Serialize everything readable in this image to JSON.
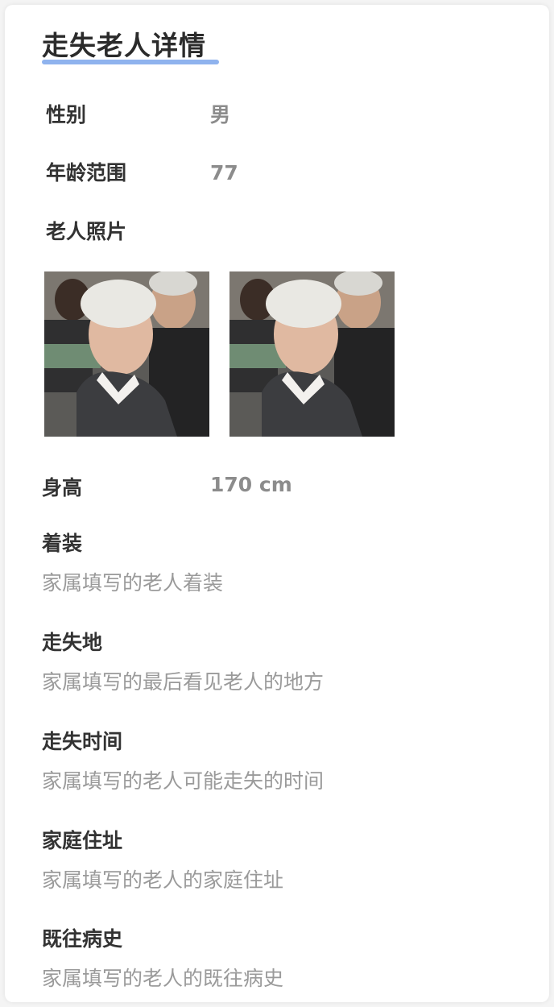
{
  "title": "走失老人详情",
  "fields": {
    "gender": {
      "label": "性别",
      "value": "男"
    },
    "age": {
      "label": "年龄范围",
      "value": "77"
    },
    "photos_label": "老人照片",
    "height": {
      "label": "身高",
      "value": "170 cm"
    }
  },
  "sections": [
    {
      "label": "着装",
      "value": "家属填写的老人着装"
    },
    {
      "label": "走失地",
      "value": "家属填写的最后看见老人的地方"
    },
    {
      "label": "走失时间",
      "value": "家属填写的老人可能走失的时间"
    },
    {
      "label": "家庭住址",
      "value": "家属填写的老人的家庭住址"
    },
    {
      "label": "既往病史",
      "value": "家属填写的老人的既往病史"
    }
  ],
  "colors": {
    "accent_underline": "#8fb3ee",
    "label_text": "#333333",
    "value_text": "#9a9a9a"
  }
}
